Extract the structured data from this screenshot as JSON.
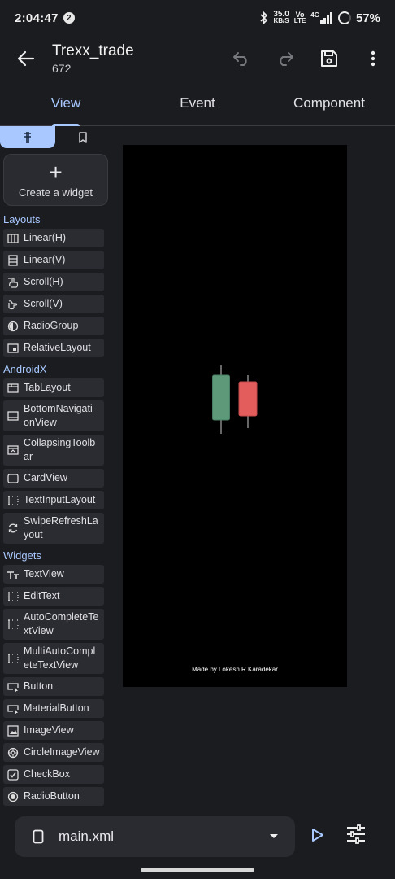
{
  "status_bar": {
    "time": "2:04:47",
    "notification_count": "2",
    "net_speed_value": "35.0",
    "net_speed_unit": "KB/S",
    "volte_top": "Vo",
    "volte_bottom": "LTE",
    "network_type": "4G",
    "battery": "57%"
  },
  "app_bar": {
    "title": "Trexx_trade",
    "subtitle": "672",
    "icons": [
      "back-arrow",
      "undo",
      "redo",
      "save",
      "more-vertical"
    ]
  },
  "tabs": [
    {
      "label": "View",
      "active": true
    },
    {
      "label": "Event",
      "active": false
    },
    {
      "label": "Component",
      "active": false
    }
  ],
  "palette": {
    "subtabs": [
      {
        "icon": "money-icon",
        "active": true
      },
      {
        "icon": "bookmark-icon",
        "active": false
      }
    ],
    "create_label": "Create a widget",
    "sections": [
      {
        "title": "Layouts",
        "items": [
          {
            "label": "Linear(H)",
            "icon": "linear-h-icon"
          },
          {
            "label": "Linear(V)",
            "icon": "linear-v-icon"
          },
          {
            "label": "Scroll(H)",
            "icon": "scroll-h-icon"
          },
          {
            "label": "Scroll(V)",
            "icon": "scroll-v-icon"
          },
          {
            "label": "RadioGroup",
            "icon": "radiogroup-icon"
          },
          {
            "label": "RelativeLayout",
            "icon": "relative-layout-icon"
          }
        ]
      },
      {
        "title": "AndroidX",
        "items": [
          {
            "label": "TabLayout",
            "icon": "tab-layout-icon"
          },
          {
            "label": "BottomNavigationView",
            "icon": "bottom-nav-icon",
            "lines": [
              "BottomNavigati",
              "onView"
            ]
          },
          {
            "label": "CollapsingToolbar",
            "icon": "collapsing-toolbar-icon",
            "lines": [
              "CollapsingToolb",
              "ar"
            ]
          },
          {
            "label": "CardView",
            "icon": "cardview-icon"
          },
          {
            "label": "TextInputLayout",
            "icon": "text-input-layout-icon"
          },
          {
            "label": "SwipeRefreshLayout",
            "icon": "swipe-refresh-icon",
            "lines": [
              "SwipeRefreshLa",
              "yout"
            ]
          }
        ]
      },
      {
        "title": "Widgets",
        "items": [
          {
            "label": "TextView",
            "icon": "textview-icon"
          },
          {
            "label": "EditText",
            "icon": "edittext-icon"
          },
          {
            "label": "AutoCompleteTextView",
            "icon": "autocomplete-icon",
            "lines": [
              "AutoCompleteTe",
              "xtView"
            ]
          },
          {
            "label": "MultiAutoCompleteTextView",
            "icon": "multi-autocomplete-icon",
            "lines": [
              "MultiAutoCompl",
              "eteTextView"
            ]
          },
          {
            "label": "Button",
            "icon": "button-icon"
          },
          {
            "label": "MaterialButton",
            "icon": "material-button-icon"
          },
          {
            "label": "ImageView",
            "icon": "imageview-icon"
          },
          {
            "label": "CircleImageView",
            "icon": "circle-imageview-icon"
          },
          {
            "label": "CheckBox",
            "icon": "checkbox-icon"
          },
          {
            "label": "RadioButton",
            "icon": "radiobutton-icon"
          }
        ]
      }
    ]
  },
  "canvas": {
    "background": "#000000",
    "credit": "Made by Lokesh R Karadekar",
    "candles": [
      {
        "name": "green-candle",
        "color": "#5e9a7a"
      },
      {
        "name": "red-candle",
        "color": "#e35d5d"
      }
    ]
  },
  "bottom_bar": {
    "file_name": "main.xml",
    "icons": [
      "file-icon",
      "dropdown-arrow-icon",
      "run-icon",
      "tune-icon"
    ]
  },
  "colors": {
    "accent": "#a8c8ff",
    "background": "#1b1c20",
    "surface": "#2b2c31"
  }
}
